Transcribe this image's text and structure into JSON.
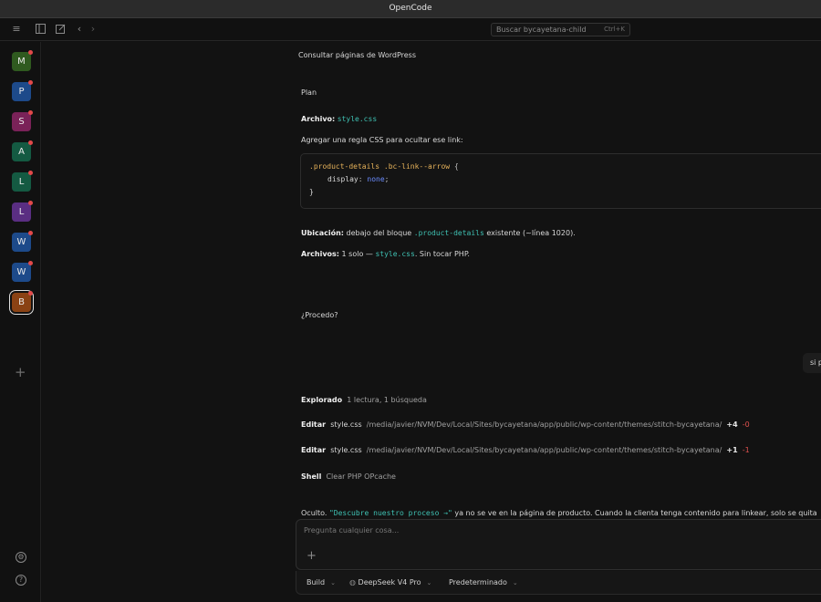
{
  "app": {
    "title": "OpenCode"
  },
  "toolbar": {
    "search_placeholder": "Buscar bycayetana-child",
    "search_shortcut": "Ctrl+K"
  },
  "projects": [
    {
      "letter": "M",
      "color": "#2f5a1f",
      "badge": true,
      "active": false
    },
    {
      "letter": "P",
      "color": "#1d4a8a",
      "badge": true,
      "active": false
    },
    {
      "letter": "S",
      "color": "#7a2258",
      "badge": true,
      "active": false
    },
    {
      "letter": "A",
      "color": "#145a42",
      "badge": true,
      "active": false
    },
    {
      "letter": "L",
      "color": "#145a42",
      "badge": true,
      "active": false
    },
    {
      "letter": "L",
      "color": "#5a2e82",
      "badge": true,
      "active": false
    },
    {
      "letter": "W",
      "color": "#1d4a8a",
      "badge": true,
      "active": false
    },
    {
      "letter": "W",
      "color": "#1d4a8a",
      "badge": true,
      "active": false
    },
    {
      "letter": "B",
      "color": "#8a4214",
      "badge": true,
      "active": true
    }
  ],
  "session": {
    "title": "Consultar páginas de WordPress",
    "plan_heading": "Plan",
    "archivo_label": "Archivo:",
    "archivo_file": "style.css",
    "instruction": "Agregar una regla CSS para ocultar ese link:",
    "code": {
      "line1_selector": ".product-details .bc-link--arrow",
      "line1_brace": "{",
      "line2_prop": "display",
      "line2_colon": ":",
      "line2_value": "none",
      "line2_semi": ";",
      "line3": "}"
    },
    "ubicacion_label": "Ubicación:",
    "ubicacion_text_a": "debajo del bloque",
    "ubicacion_code": ".product-details",
    "ubicacion_text_b": "existente (~línea 1020).",
    "archivos_label": "Archivos:",
    "archivos_text_a": "1 solo —",
    "archivos_code": "style.css",
    "archivos_text_b": ". Sin tocar PHP.",
    "question": "¿Procedo?"
  },
  "user_message": "si p",
  "activity": {
    "explorado_label": "Explorado",
    "explorado_detail": "1 lectura, 1 búsqueda",
    "edits": [
      {
        "label": "Editar",
        "file": "style.css",
        "path": "/media/javier/NVM/Dev/Local/Sites/bycayetana/app/public/wp-content/themes/stitch-bycayetana/",
        "added": "+4",
        "removed": "-0"
      },
      {
        "label": "Editar",
        "file": "style.css",
        "path": "/media/javier/NVM/Dev/Local/Sites/bycayetana/app/public/wp-content/themes/stitch-bycayetana/",
        "added": "+1",
        "removed": "-1"
      }
    ],
    "shell_label": "Shell",
    "shell_detail": "Clear PHP OPcache"
  },
  "result": {
    "text_a": "Oculto.",
    "code": "\"Descubre nuestro proceso →\"",
    "text_b": "ya no se ve en la página de producto. Cuando la clienta tenga contenido para linkear, solo se quita"
  },
  "composer": {
    "placeholder": "Pregunta cualquier cosa...",
    "mode": "Build",
    "model": "DeepSeek V4 Pro",
    "variant": "Predeterminado"
  }
}
